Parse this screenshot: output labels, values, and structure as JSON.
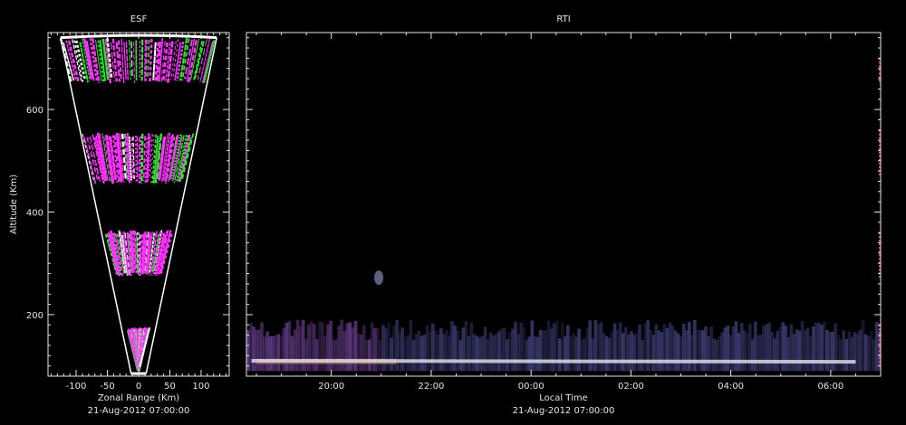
{
  "chart_data": [
    {
      "type": "heatmap",
      "title": "ESF",
      "xlabel": "Zonal Range (Km)",
      "ylabel": "Altitude (Km)",
      "footer": "21-Aug-2012 07:00:00",
      "xlim": [
        -145,
        145
      ],
      "ylim": [
        80,
        750
      ],
      "xticks": [
        -100,
        -50,
        0,
        50,
        100
      ],
      "xtick_labels": [
        "-100",
        "-50",
        "0",
        "50",
        "100"
      ],
      "yticks": [
        200,
        400,
        600
      ],
      "ytick_labels": [
        "200",
        "400",
        "600"
      ],
      "fan": {
        "apex_alt": 80,
        "top_alt": 740,
        "half_width_at_top": 125
      },
      "echo_bands": [
        {
          "alt_min": 90,
          "alt_max": 175
        },
        {
          "alt_min": 275,
          "alt_max": 365
        },
        {
          "alt_min": 455,
          "alt_max": 555
        },
        {
          "alt_min": 650,
          "alt_max": 740
        }
      ],
      "colors": {
        "echo_primary": "#ff33ff",
        "echo_secondary": "#22ee22",
        "echo_tertiary": "#ffffff",
        "outline": "#ffffff"
      }
    },
    {
      "type": "heatmap",
      "title": "RTI",
      "xlabel": "Local Time",
      "ylabel": "",
      "footer": "21-Aug-2012 07:00:00",
      "x_unit": "hours",
      "xlim": [
        18.3,
        31.0
      ],
      "ylim": [
        80,
        750
      ],
      "xticks": [
        20,
        22,
        24,
        26,
        28,
        30
      ],
      "xtick_labels": [
        "20:00",
        "22:00",
        "00:00",
        "02:00",
        "04:00",
        "06:00"
      ],
      "layers": [
        {
          "name": "E-region trace",
          "alt_center": 108,
          "alt_halfwidth": 6,
          "color": "#d8dde6"
        },
        {
          "name": "lower echo band",
          "alt_min": 90,
          "alt_max": 190,
          "color": "#4a4a8c"
        },
        {
          "name": "early-evening band",
          "alt_min": 110,
          "alt_max": 195,
          "color": "#7a4aa8"
        }
      ],
      "colors": {
        "background": "#000000",
        "axis": "#e6e6e6",
        "right_edge": "#ff4466"
      }
    }
  ]
}
